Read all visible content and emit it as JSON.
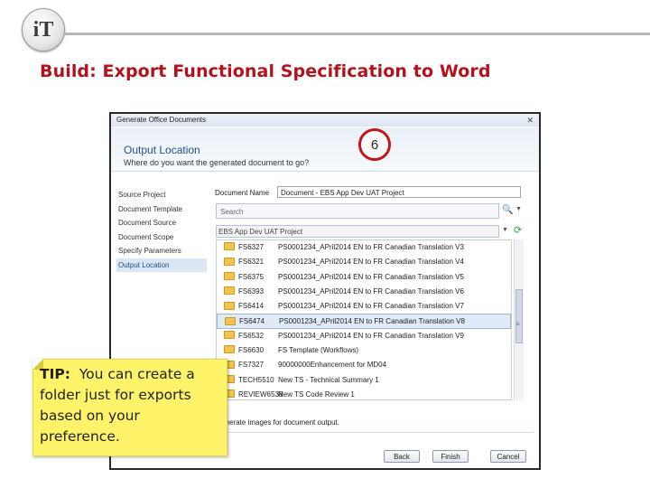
{
  "logo": {
    "text": "iT"
  },
  "slide": {
    "title": "Build: Export Functional Specification to Word"
  },
  "dialog": {
    "title": "Generate Office Documents",
    "close_icon": "close-icon",
    "header": {
      "title": "Output Location",
      "subtitle": "Where do you want the generated document to go?"
    },
    "step_badge": "6",
    "nav": [
      {
        "label": "Source Project",
        "selected": false
      },
      {
        "label": "Document Template",
        "selected": false
      },
      {
        "label": "Document Source",
        "selected": false
      },
      {
        "label": "Document Scope",
        "selected": false
      },
      {
        "label": "Specify Parameters",
        "selected": false
      },
      {
        "label": "Output Location",
        "selected": true
      }
    ],
    "document_name": {
      "label": "Document Name",
      "value": "Document - EBS App Dev UAT Project"
    },
    "search": {
      "placeholder": "Search"
    },
    "project": {
      "value": "EBS App Dev UAT Project"
    },
    "files": [
      {
        "code": "FS6327",
        "name": "PS0001234_APril2014 EN to FR Canadian Translation V3",
        "selected": false
      },
      {
        "code": "FS6321",
        "name": "PS0001234_APril2014 EN to FR Canadian Translation V4",
        "selected": false
      },
      {
        "code": "FS6375",
        "name": "PS0001234_APril2014 EN to FR Canadian Translation V5",
        "selected": false
      },
      {
        "code": "FS6393",
        "name": "PS0001234_APril2014 EN to FR Canadian Translation V6",
        "selected": false
      },
      {
        "code": "FS6414",
        "name": "PS0001234_APril2014 EN to FR Canadian Translation V7",
        "selected": false
      },
      {
        "code": "FS6474",
        "name": "PS0001234_APril2014 EN to FR Canadian Translation V8",
        "selected": true
      },
      {
        "code": "FS6532",
        "name": "PS0001234_APril2014 EN to FR Canadian Translation V9",
        "selected": false
      },
      {
        "code": "FS6630",
        "name": "FS Template (Workflows)",
        "selected": false
      },
      {
        "code": "FS7327",
        "name": "90000000Enhancement for MD04",
        "selected": false
      },
      {
        "code": "TECH5510",
        "name": "New TS - Technical Summary 1",
        "selected": false
      },
      {
        "code": "REVIEW6538",
        "name": "New TS Code Review 1",
        "selected": false
      }
    ],
    "generate_images_label": "Generate images for document output.",
    "buttons": {
      "back": "Back",
      "finish": "Finish",
      "cancel": "Cancel"
    }
  },
  "tip": {
    "prefix": "TIP:",
    "text": "You can create a folder just for exports based on your preference."
  }
}
